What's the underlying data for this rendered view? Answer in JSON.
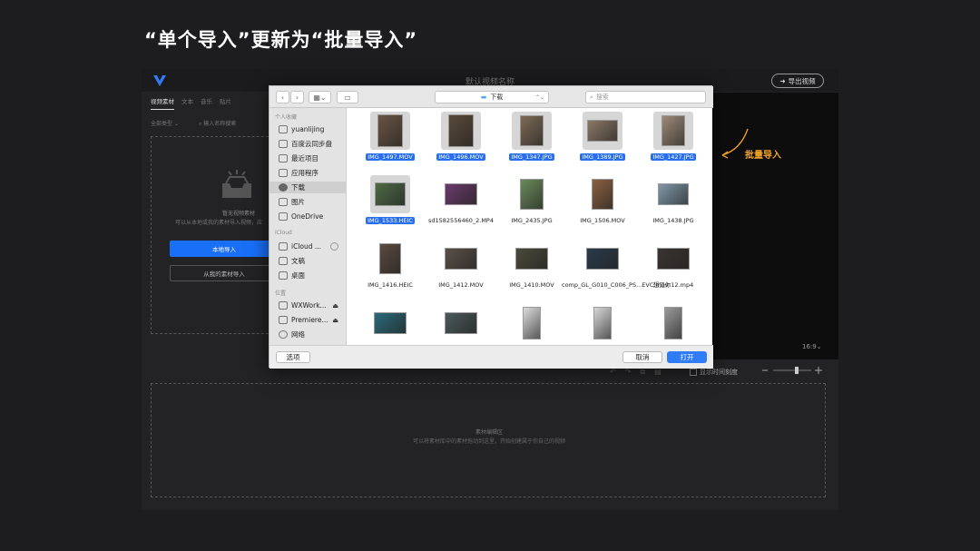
{
  "slide_title": "“单个导入”更新为“批量导入”",
  "annotation": "批量导入",
  "app": {
    "title": "默认视频名称",
    "export_label": "导出视频",
    "tabs": [
      "视频素材",
      "文本",
      "音乐",
      "贴片"
    ],
    "filter_label": "全部类型",
    "search_placeholder": "输入名称搜索",
    "empty_title": "暂无视频素材",
    "empty_desc": "可以从本地或我的素材导入视频，应",
    "local_import": "本地导入",
    "library_import": "从我的素材导入",
    "ratio": "16:9",
    "show_time_scale": "显示时间刻度",
    "edit_area_title": "素材编辑区",
    "edit_area_desc": "可以将素材库中的素材拖动到这里，开始创建属于你自己的视频"
  },
  "dialog": {
    "location": "下载",
    "search_placeholder": "搜索",
    "sidebar": {
      "favorites_header": "个人收藏",
      "favorites": [
        "yuanlijing",
        "百度云同步盘",
        "最近项目",
        "应用程序",
        "下载",
        "图片",
        "OneDrive"
      ],
      "selected": "下载",
      "icloud_header": "iCloud",
      "icloud": [
        "iCloud ...",
        "文稿",
        "桌面"
      ],
      "locations_header": "位置",
      "locations": [
        "WXWork...",
        "Premiere...",
        "网络"
      ]
    },
    "files": [
      {
        "name": "IMG_1497.MOV",
        "selected": true
      },
      {
        "name": "IMG_1496.MOV",
        "selected": true
      },
      {
        "name": "IMG_1347.JPG",
        "selected": true
      },
      {
        "name": "IMG_1389.JPG",
        "selected": true
      },
      {
        "name": "IMG_1427.JPG",
        "selected": true
      },
      {
        "name": "IMG_1533.HEIC",
        "selected": true
      },
      {
        "name": "sd1582556460_2.MP4",
        "selected": false
      },
      {
        "name": "IMG_2435.JPG",
        "selected": false
      },
      {
        "name": "IMG_1506.MOV",
        "selected": false
      },
      {
        "name": "IMG_1438.JPG",
        "selected": false
      },
      {
        "name": "IMG_1416.HEIC",
        "selected": false
      },
      {
        "name": "IMG_1412.MOV",
        "selected": false
      },
      {
        "name": "IMG_1410.MOV",
        "selected": false
      },
      {
        "name": "comp_GL_G010_C006_PS...EVC.mov",
        "selected": false
      },
      {
        "name": "想见你12.mp4",
        "selected": false
      },
      {
        "name": "",
        "selected": false
      },
      {
        "name": "",
        "selected": false
      },
      {
        "name": "",
        "selected": false
      },
      {
        "name": "",
        "selected": false
      },
      {
        "name": "",
        "selected": false
      }
    ],
    "options_label": "选项",
    "cancel_label": "取消",
    "open_label": "打开"
  },
  "colors": {
    "accent": "#2f7cf6",
    "annotation": "#f5a623",
    "background": "#1d1d1f"
  }
}
